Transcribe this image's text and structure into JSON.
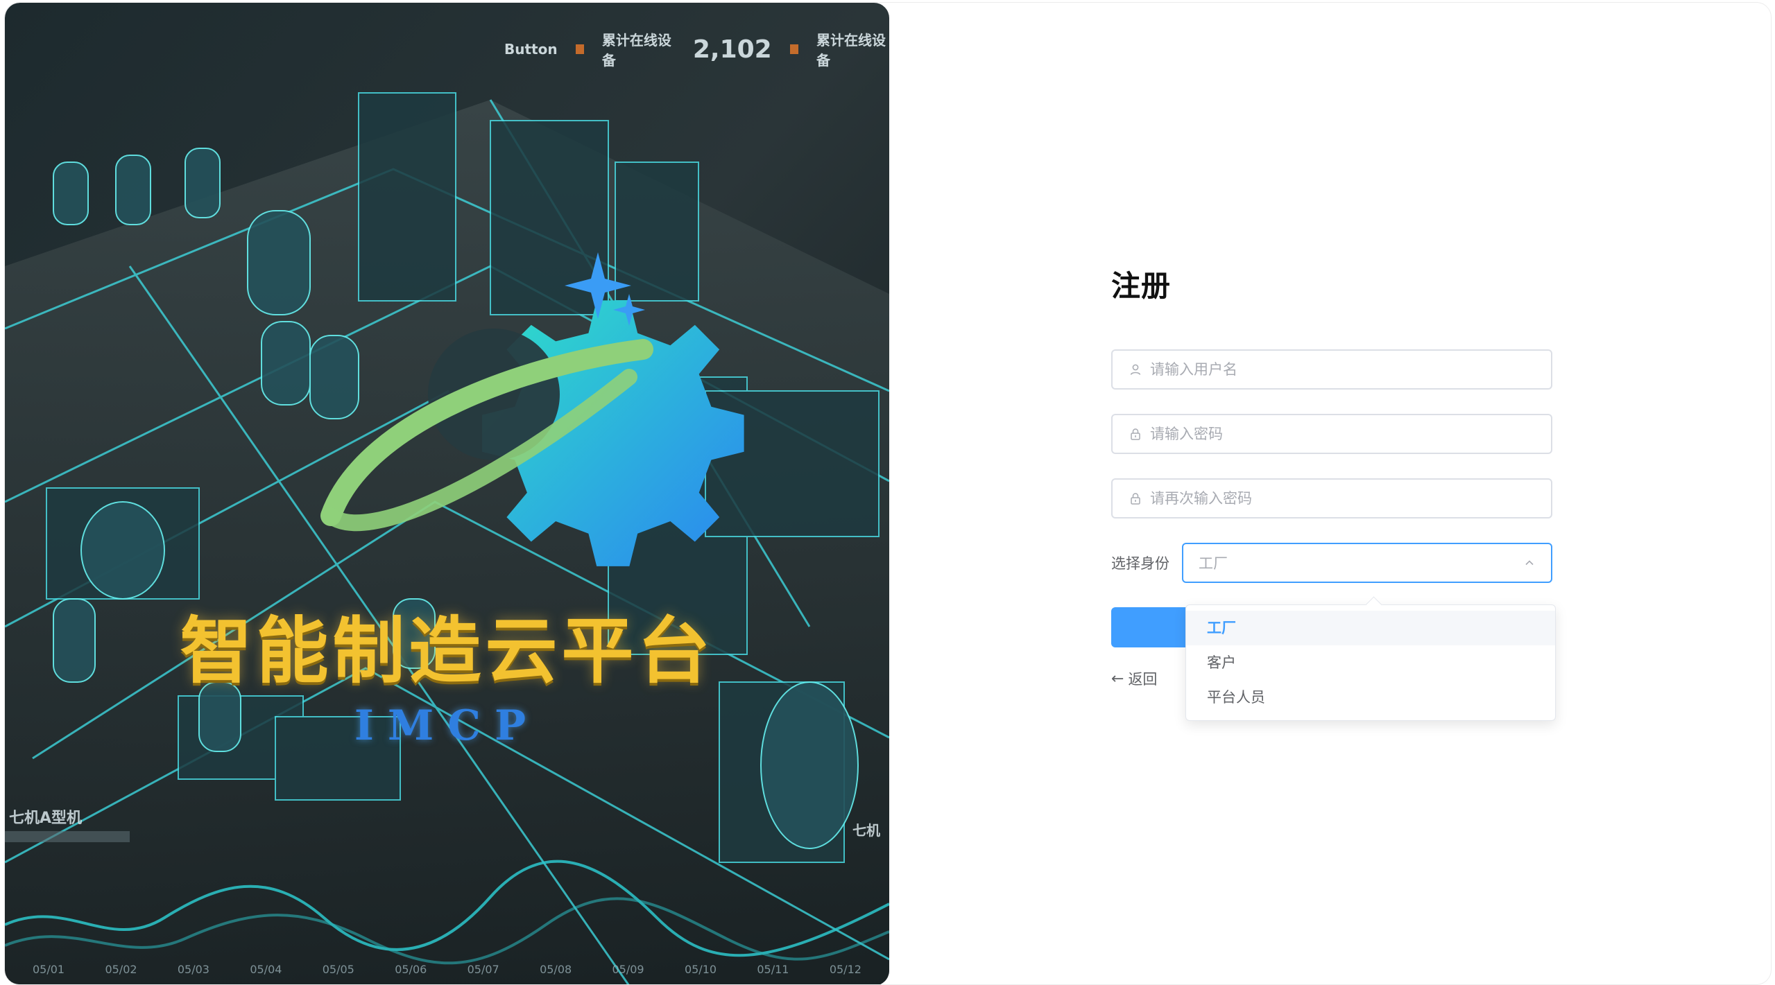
{
  "hero": {
    "title": "智能制造云平台",
    "subtitle": "IMCP",
    "topbar": {
      "button_text": "Button",
      "label_a": "累计在线设备",
      "value_a": "2,102",
      "label_b": "累计在线设备"
    },
    "corner_label": "七机A型机",
    "side_label": "七机",
    "axis_ticks": [
      "05/01",
      "05/02",
      "05/03",
      "05/04",
      "05/05",
      "05/06",
      "05/07",
      "05/08",
      "05/09",
      "05/10",
      "05/11",
      "05/12"
    ],
    "colors": {
      "title": "#f3c230",
      "subtitle": "#2f7fe0",
      "wire": "#3fe0e8",
      "gear_from": "#2fe0c8",
      "gear_to": "#2a86f0",
      "ring": "#8fd07a"
    }
  },
  "form": {
    "title": "注册",
    "username_placeholder": "请输入用户名",
    "password_placeholder": "请输入密码",
    "confirm_placeholder": "请再次输入密码",
    "role_label": "选择身份",
    "role_value": "工厂",
    "submit_label": "",
    "back_label": "返回",
    "icons": {
      "username": "user-icon",
      "password": "lock-icon",
      "confirm": "lock-icon",
      "select": "chevron-up-icon",
      "back": "arrow-left-icon"
    }
  },
  "dropdown": {
    "options": [
      {
        "label": "工厂",
        "selected": true
      },
      {
        "label": "客户",
        "selected": false
      },
      {
        "label": "平台人员",
        "selected": false
      }
    ]
  },
  "theme": {
    "primary": "#409eff",
    "border": "#dcdfe6",
    "placeholder": "#a8abb2",
    "text": "#606266"
  }
}
